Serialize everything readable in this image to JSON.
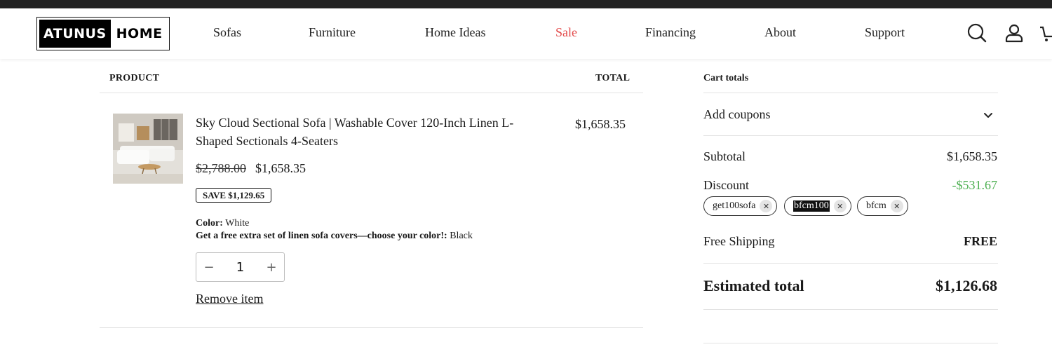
{
  "header": {
    "logo_left": "ATUNUS",
    "logo_right": "HOME",
    "nav": [
      "Sofas",
      "Furniture",
      "Home Ideas",
      "Sale",
      "Financing",
      "About",
      "Support"
    ]
  },
  "cart": {
    "col_product": "PRODUCT",
    "col_total": "TOTAL",
    "item": {
      "title": "Sky Cloud Sectional Sofa | Washable Cover 120-Inch Linen L-Shaped Sectionals 4-Seaters",
      "line_total": "$1,658.35",
      "original_price": "$2,788.00",
      "price": "$1,658.35",
      "save_badge": "SAVE $1,129.65",
      "color_label": "Color:",
      "color_value": "White",
      "extra_label": "Get a free extra set of linen sofa covers—choose your color!:",
      "extra_value": "Black",
      "quantity": "1",
      "minus": "−",
      "plus": "+",
      "remove_label": "Remove item"
    }
  },
  "totals": {
    "title": "Cart totals",
    "add_coupons": "Add coupons",
    "subtotal_label": "Subtotal",
    "subtotal_value": "$1,658.35",
    "discount_label": "Discount",
    "discount_value": "-$531.67",
    "coupons": [
      "get100sofa",
      "bfcm100",
      "bfcm"
    ],
    "shipping_label": "Free Shipping",
    "shipping_value": "FREE",
    "estimated_label": "Estimated total",
    "estimated_value": "$1,126.68"
  },
  "colors": {
    "sale": "#e34b4b",
    "discount": "#4caf50"
  },
  "icons": [
    "search-icon",
    "account-icon",
    "cart-icon",
    "chevron-down-icon",
    "remove-coupon-icon"
  ]
}
